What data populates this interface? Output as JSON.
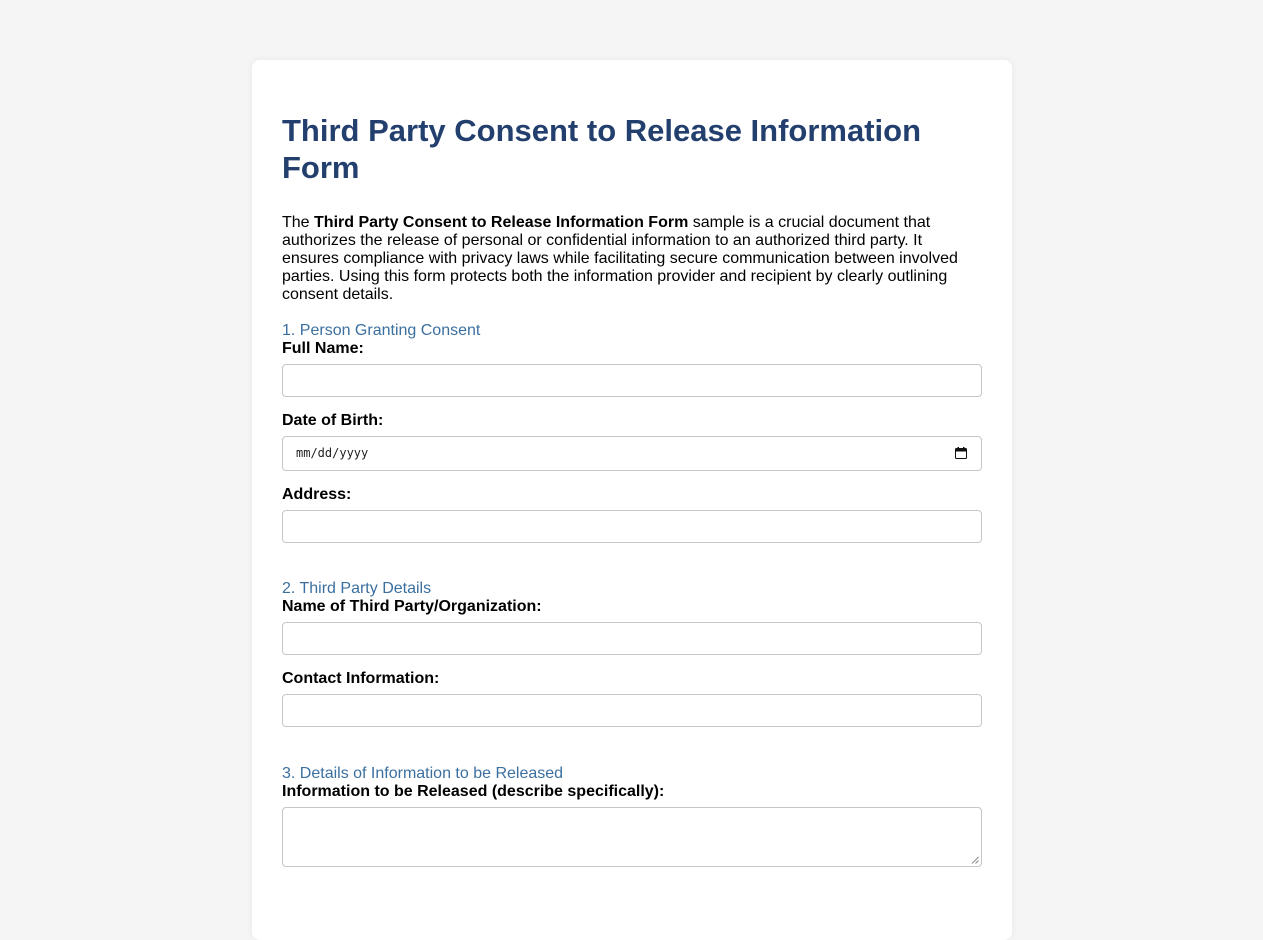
{
  "form": {
    "title": "Third Party Consent to Release Information Form",
    "intro": {
      "prefix": "The ",
      "bold": "Third Party Consent to Release Information Form",
      "suffix": " sample is a crucial document that authorizes the release of personal or confidential information to an authorized third party. It ensures compliance with privacy laws while facilitating secure communication between involved parties. Using this form protects both the information provider and recipient by clearly outlining consent details."
    },
    "sections": [
      {
        "heading": "1. Person Granting Consent",
        "fields": [
          {
            "label": "Full Name:",
            "value": ""
          },
          {
            "label": "Date of Birth:",
            "placeholder": "mm/dd/yyyy"
          },
          {
            "label": "Address:",
            "value": ""
          }
        ]
      },
      {
        "heading": "2. Third Party Details",
        "fields": [
          {
            "label": "Name of Third Party/Organization:",
            "value": ""
          },
          {
            "label": "Contact Information:",
            "value": ""
          }
        ]
      },
      {
        "heading": "3. Details of Information to be Released",
        "fields": [
          {
            "label": "Information to be Released (describe specifically):",
            "value": ""
          }
        ]
      }
    ]
  },
  "colors": {
    "background": "#f5f5f5",
    "card": "#ffffff",
    "title": "#233f6e",
    "section_heading": "#3b6fa0",
    "field_border": "#c6c6c6"
  },
  "icons": {
    "date_picker": "calendar-icon",
    "textarea_resize": "resize-handle-icon"
  }
}
